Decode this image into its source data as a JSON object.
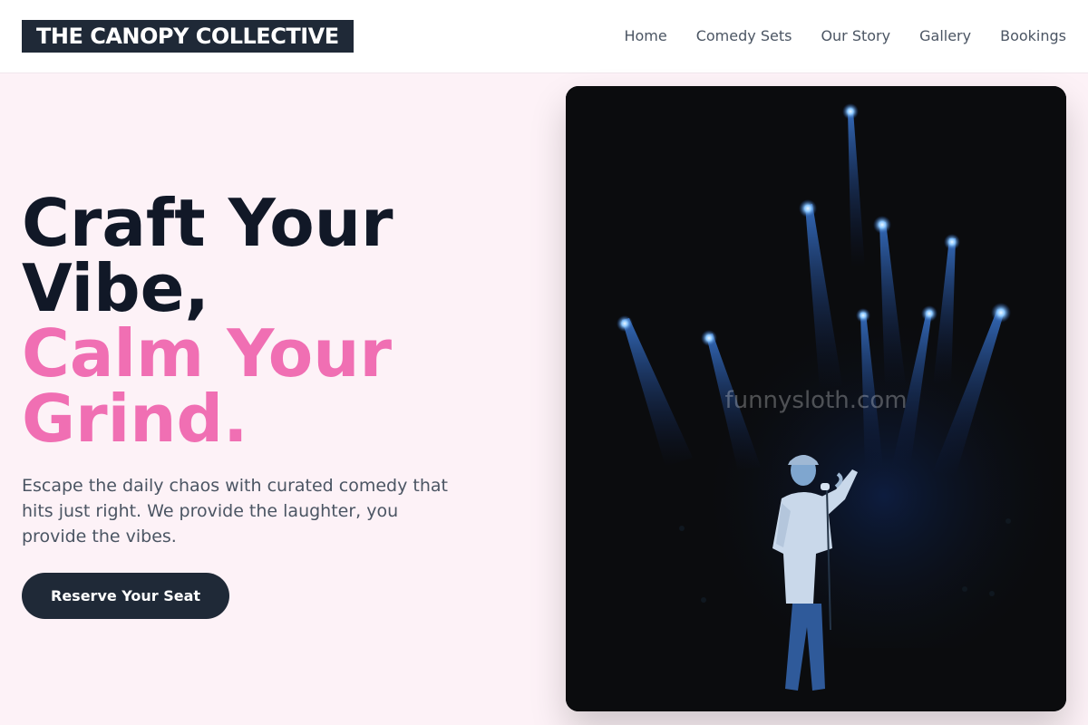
{
  "brand": {
    "name": "THE CANOPY COLLECTIVE"
  },
  "nav": {
    "items": [
      "Home",
      "Comedy Sets",
      "Our Story",
      "Gallery",
      "Bookings"
    ]
  },
  "hero": {
    "headline_lines": [
      "Craft Your",
      "Vibe,"
    ],
    "headline_accent_lines": [
      "Calm Your",
      "Grind."
    ],
    "description": "Escape the daily chaos with curated comedy that hits just right. We provide the laughter, you provide the vibes.",
    "cta_label": "Reserve Your Seat"
  },
  "image": {
    "subject": "comedian-on-stage-with-microphone",
    "watermark": "funnysloth.com"
  },
  "colors": {
    "page_bg": "#fdf2f7",
    "dark": "#1f2937",
    "headline": "#111827",
    "accent": "#f06fb3",
    "body_text": "#4b5563"
  }
}
